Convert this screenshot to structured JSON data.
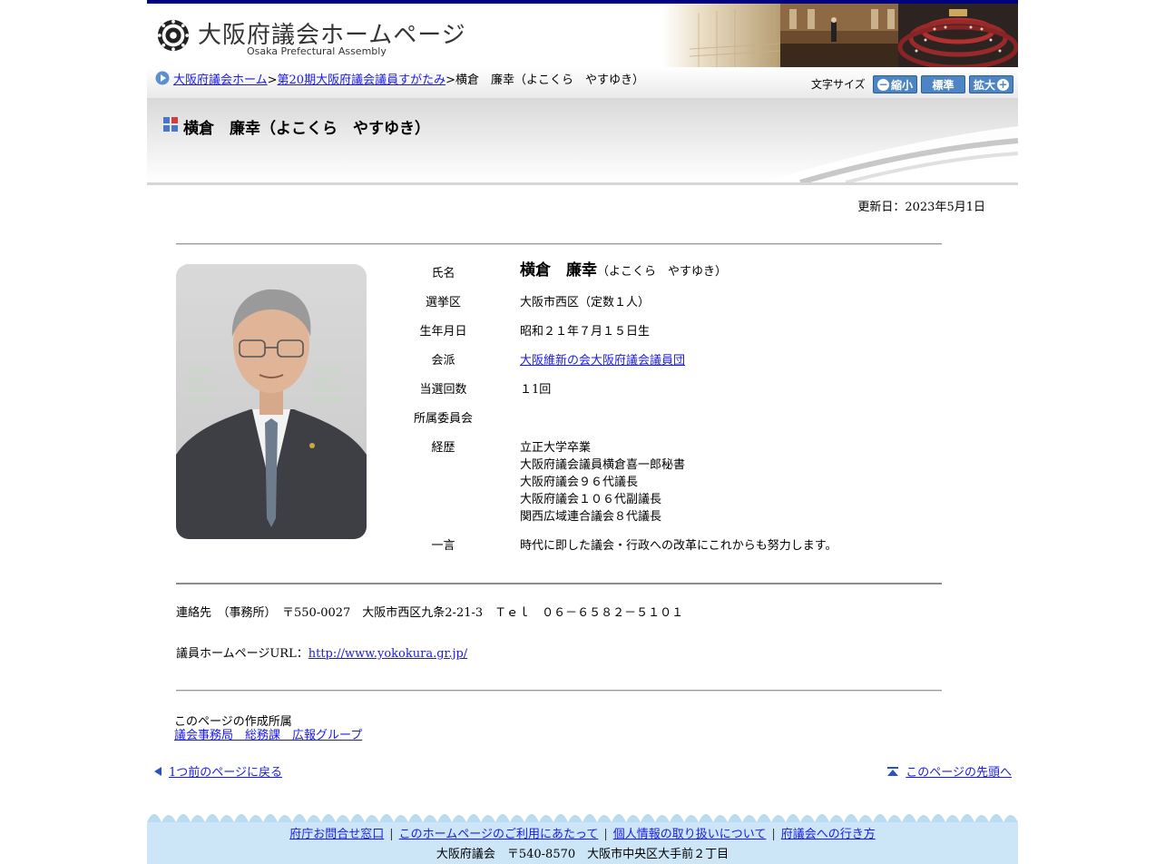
{
  "header": {
    "site_title": "大阪府議会ホームページ",
    "site_subtitle": "Osaka Prefectural Assembly",
    "emblem_icon": "osaka-emblem-icon",
    "accent_color": "#000080"
  },
  "breadcrumb": {
    "items": [
      {
        "label": "大阪府議会ホーム",
        "link": true
      },
      {
        "label": "第20期大阪府議会議員すがたみ",
        "link": true
      },
      {
        "label": "横倉　廉幸（よこくら　やすゆき）",
        "link": false
      }
    ],
    "separator": ">"
  },
  "font_size": {
    "label": "文字サイズ",
    "shrink": "縮小",
    "standard": "標準",
    "enlarge": "拡大"
  },
  "page_title": "横倉　廉幸（よこくら　やすゆき）",
  "updated": "更新日：2023年5月1日",
  "profile": {
    "name_label": "氏名",
    "name": "横倉　廉幸",
    "name_reading": "（よこくら　やすゆき）",
    "district_label": "選挙区",
    "district": "大阪市西区（定数１人）",
    "birth_label": "生年月日",
    "birth": "昭和２１年７月１５日生",
    "faction_label": "会派",
    "faction": "大阪維新の会大阪府議会議員団",
    "wins_label": "当選回数",
    "wins": "１1回",
    "committee_label": "所属委員会",
    "committee": "",
    "career_label": "経歴",
    "career": [
      "立正大学卒業",
      "大阪府議会議員横倉喜一郎秘書",
      "大阪府議会９６代議長",
      "大阪府議会１０６代副議長",
      "関西広域連合議会８代議長"
    ],
    "comment_label": "一言",
    "comment": "時代に即した議会・行政への改革にこれからも努力します。"
  },
  "contact": {
    "text": "連絡先　（事務所）　〒550-0027　大阪市西区九条2-21-3　Ｔｅｌ　０６－６５８２－５１０１",
    "hp_label": "議員ホームページURL：",
    "hp_url": "http://www.yokokura.gr.jp/"
  },
  "creator": {
    "label": "このページの作成所属",
    "dept": "議会事務局　総務課　広報グループ"
  },
  "nav": {
    "back": "1つ前のページに戻る",
    "top": "このページの先頭へ"
  },
  "footer": {
    "links": [
      "府庁お問合せ窓口",
      "このホームページのご利用にあたって",
      "個人情報の取り扱いについて",
      "府議会への行き方"
    ],
    "address": "大阪府議会　〒540-8570　大阪市中央区大手前２丁目"
  }
}
